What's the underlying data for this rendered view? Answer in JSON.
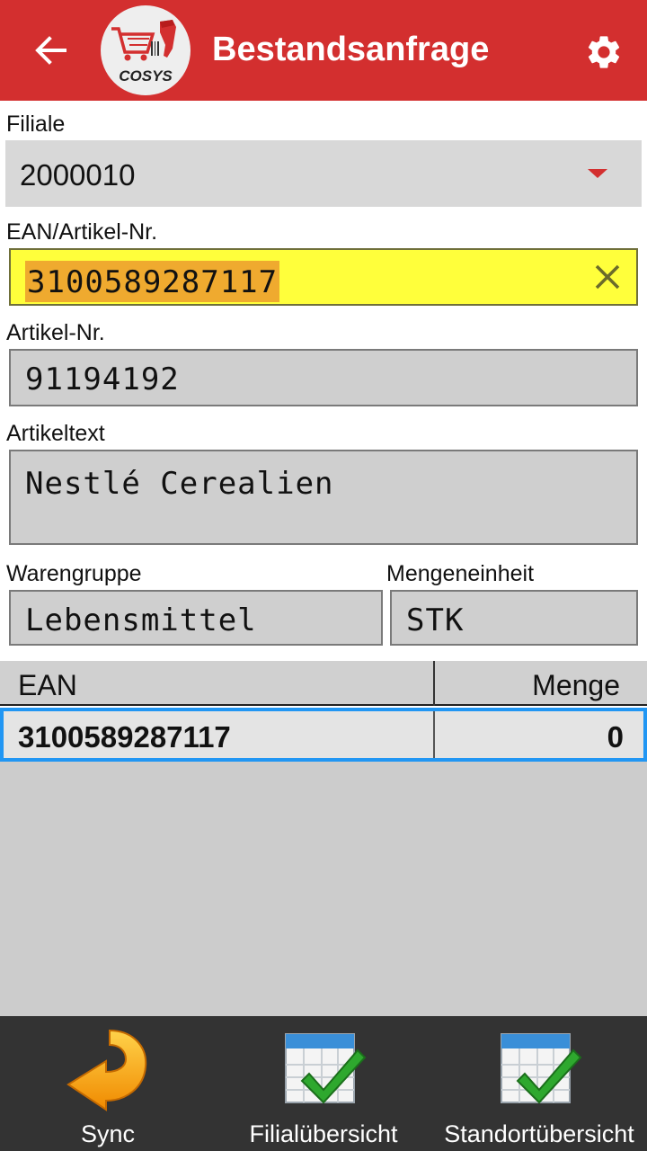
{
  "header": {
    "title": "Bestandsanfrage",
    "back_icon": "arrow-left-icon",
    "settings_icon": "gear-icon",
    "logo_text": "COSYS",
    "background": "#d32f2f"
  },
  "form": {
    "filiale": {
      "label": "Filiale",
      "value": "2000010"
    },
    "ean": {
      "label": "EAN/Artikel-Nr.",
      "value": "3100589287117",
      "highlight": "#ffff3b"
    },
    "artikel_nr": {
      "label": "Artikel-Nr.",
      "value": "91194192"
    },
    "artikeltext": {
      "label": "Artikeltext",
      "value": "Nestlé Cerealien"
    },
    "warengruppe": {
      "label": "Warengruppe",
      "value": "Lebensmittel"
    },
    "mengeneinheit": {
      "label": "Mengeneinheit",
      "value": "STK"
    }
  },
  "table": {
    "columns": [
      "EAN",
      "Menge"
    ],
    "rows": [
      {
        "ean": "3100589287117",
        "menge": "0"
      }
    ],
    "selection_color": "#2196f3"
  },
  "bottom_bar": {
    "buttons": [
      {
        "label": "Sync",
        "icon": "sync-arrow-icon"
      },
      {
        "label": "Filialübersicht",
        "icon": "table-check-icon"
      },
      {
        "label": "Standortübersicht",
        "icon": "table-check-icon"
      }
    ]
  }
}
